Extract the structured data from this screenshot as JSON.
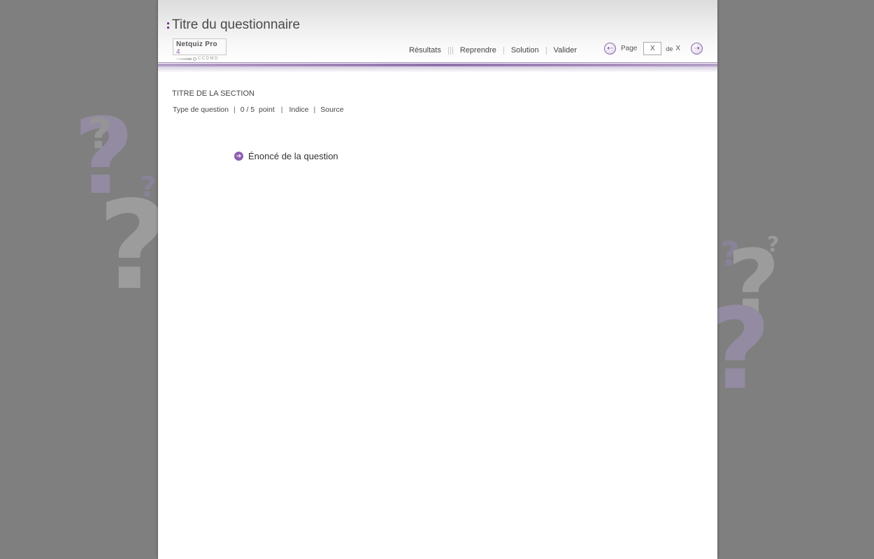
{
  "header": {
    "title": "Titre du questionnaire",
    "logo": {
      "name": "Netquiz Pro",
      "version": "4",
      "org": "CCDMD"
    }
  },
  "menu": {
    "results": "Résultats",
    "retry": "Reprendre",
    "solution": "Solution",
    "validate": "Valider"
  },
  "pager": {
    "page_label": "Page",
    "current_page": "X",
    "of_label": "de",
    "total_pages": "X"
  },
  "section": {
    "title": "TITRE DE LA SECTION",
    "question_type": "Type de question",
    "score": "0 / 5  point",
    "hint": "Indice",
    "source": "Source"
  },
  "question": {
    "statement": "Énoncé de la question"
  },
  "colors": {
    "accent": "#8c5fb0",
    "background": "#7f7f7f",
    "panel": "#ffffff"
  },
  "icons": {
    "prev": "arrow-left-circle-icon",
    "next": "arrow-right-circle-icon",
    "statement": "arrow-right-circle-icon"
  }
}
